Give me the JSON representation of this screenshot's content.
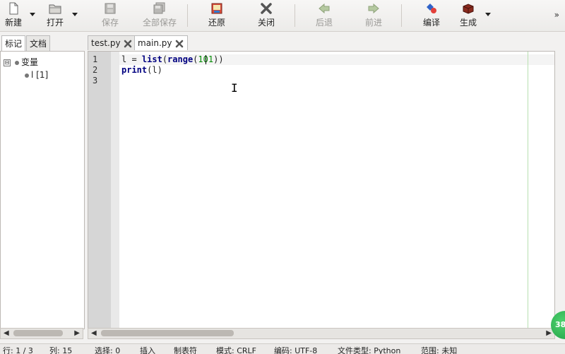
{
  "toolbar": {
    "new_label": "新建",
    "open_label": "打开",
    "save_label": "保存",
    "save_all_label": "全部保存",
    "revert_label": "还原",
    "close_label": "关闭",
    "back_label": "后退",
    "forward_label": "前进",
    "compile_label": "编译",
    "build_label": "生成",
    "more_label": "»"
  },
  "sidebar": {
    "tabs": [
      {
        "label": "标记",
        "active": true
      },
      {
        "label": "文档",
        "active": false
      }
    ],
    "tree": {
      "group_label": "变量",
      "expander": "⊟",
      "items": [
        {
          "label": "l [1]"
        }
      ]
    }
  },
  "editor": {
    "tabs": [
      {
        "label": "test.py",
        "active": false
      },
      {
        "label": "main.py",
        "active": true
      }
    ],
    "line_numbers": [
      "1",
      "2",
      "3"
    ],
    "lines": [
      "l = list(range(101))",
      "print(l)",
      ""
    ]
  },
  "statusbar": {
    "line": "行: 1 / 3",
    "col": "列: 15",
    "sel": "选择: 0",
    "mode": "插入",
    "tab": "制表符",
    "mode2": "模式: CRLF",
    "encoding": "编码: UTF-8",
    "filetype": "文件类型: Python",
    "scope": "范围: 未知"
  },
  "badge": {
    "text": "38"
  }
}
